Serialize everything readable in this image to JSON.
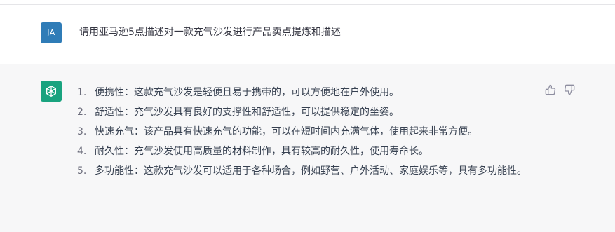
{
  "user_message": {
    "avatar_initials": "JA",
    "text": "请用亚马逊5点描述对一款充气沙发进行产品卖点提炼和描述"
  },
  "assistant_message": {
    "items": [
      {
        "number": "1.",
        "text": "便携性：这款充气沙发是轻便且易于携带的，可以方便地在户外使用。"
      },
      {
        "number": "2.",
        "text": "舒适性：充气沙发具有良好的支撑性和舒适性，可以提供稳定的坐姿。"
      },
      {
        "number": "3.",
        "text": "快速充气：该产品具有快速充气的功能，可以在短时间内充满气体，使用起来非常方便。"
      },
      {
        "number": "4.",
        "text": "耐久性：充气沙发使用高质量的材料制作，具有较高的耐久性，使用寿命长。"
      },
      {
        "number": "5.",
        "text": "多功能性：这款充气沙发可以适用于各种场合，例如野营、户外活动、家庭娱乐等，具有多功能性。"
      }
    ]
  },
  "icons": {
    "assistant_avatar": "openai-logo-icon",
    "feedback_up": "thumbs-up-icon",
    "feedback_down": "thumbs-down-icon"
  },
  "colors": {
    "user_avatar": "#2f7cb7",
    "assistant_avatar": "#19a37f",
    "assistant_background": "#f7f7f8"
  }
}
